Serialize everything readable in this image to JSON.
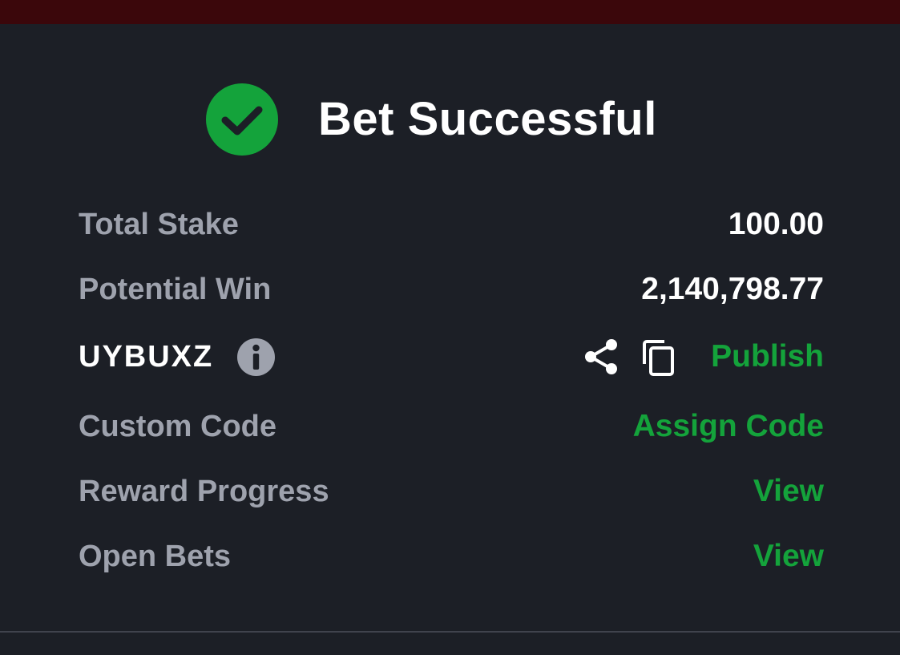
{
  "header": {
    "title": "Bet Successful",
    "status_icon": "check-circle-icon",
    "status_color": "#14a33b"
  },
  "summary": {
    "total_stake": {
      "label": "Total Stake",
      "value": "100.00"
    },
    "potential_win": {
      "label": "Potential Win",
      "value": "2,140,798.77"
    },
    "booking_code": {
      "code": "UYBUXZ",
      "info_icon": "info-icon",
      "share_icon": "share-icon",
      "copy_icon": "copy-icon",
      "publish_label": "Publish"
    },
    "custom_code": {
      "label": "Custom Code",
      "action": "Assign Code"
    },
    "reward_progress": {
      "label": "Reward Progress",
      "action": "View"
    },
    "open_bets": {
      "label": "Open Bets",
      "action": "View"
    }
  },
  "theme": {
    "background": "#1c1f26",
    "top_strip": "#3b070b",
    "label_color": "#9ea2ad",
    "value_color": "#ffffff",
    "accent": "#14a33b"
  }
}
